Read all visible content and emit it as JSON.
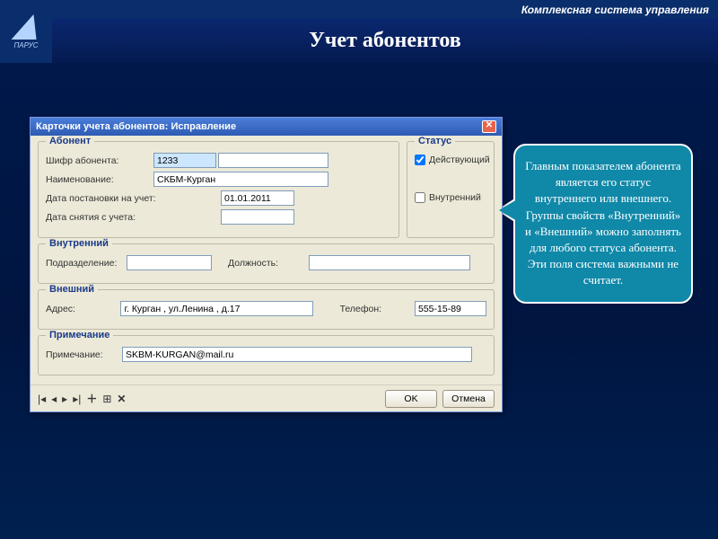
{
  "header": {
    "system_name": "Комплексная система управления",
    "page_title": "Учет абонентов",
    "logo_text": "ПАРУС"
  },
  "dialog": {
    "title": "Карточки учета абонентов: Исправление",
    "sections": {
      "abonent": {
        "legend": "Абонент",
        "code_label": "Шифр абонента:",
        "code_value": "1233",
        "name_label": "Наименование:",
        "name_value": "СКБМ-Курган",
        "reg_date_label": "Дата постановки на учет:",
        "reg_date_value": "01.01.2011",
        "dereg_date_label": "Дата снятия с учета:",
        "dereg_date_value": ""
      },
      "status": {
        "legend": "Статус",
        "active_label": "Действующий",
        "active_checked": true,
        "internal_label": "Внутренний",
        "internal_checked": false
      },
      "internal": {
        "legend": "Внутренний",
        "dept_label": "Подразделение:",
        "dept_value": "",
        "pos_label": "Должность:",
        "pos_value": ""
      },
      "external": {
        "legend": "Внешний",
        "addr_label": "Адрес:",
        "addr_value": "г. Курган , ул.Ленина , д.17",
        "tel_label": "Телефон:",
        "tel_value": "555-15-89"
      },
      "note": {
        "legend": "Примечание",
        "note_label": "Примечание:",
        "note_value": "SKBM-KURGAN@mail.ru"
      }
    },
    "buttons": {
      "ok": "OK",
      "cancel": "Отмена"
    }
  },
  "callout": {
    "text": "Главным показателем абонента является его статус внутреннего или внешнего. Группы свойств «Внутренний» и «Внешний» можно заполнять для любого статуса абонента. Эти поля система важными не считает."
  }
}
